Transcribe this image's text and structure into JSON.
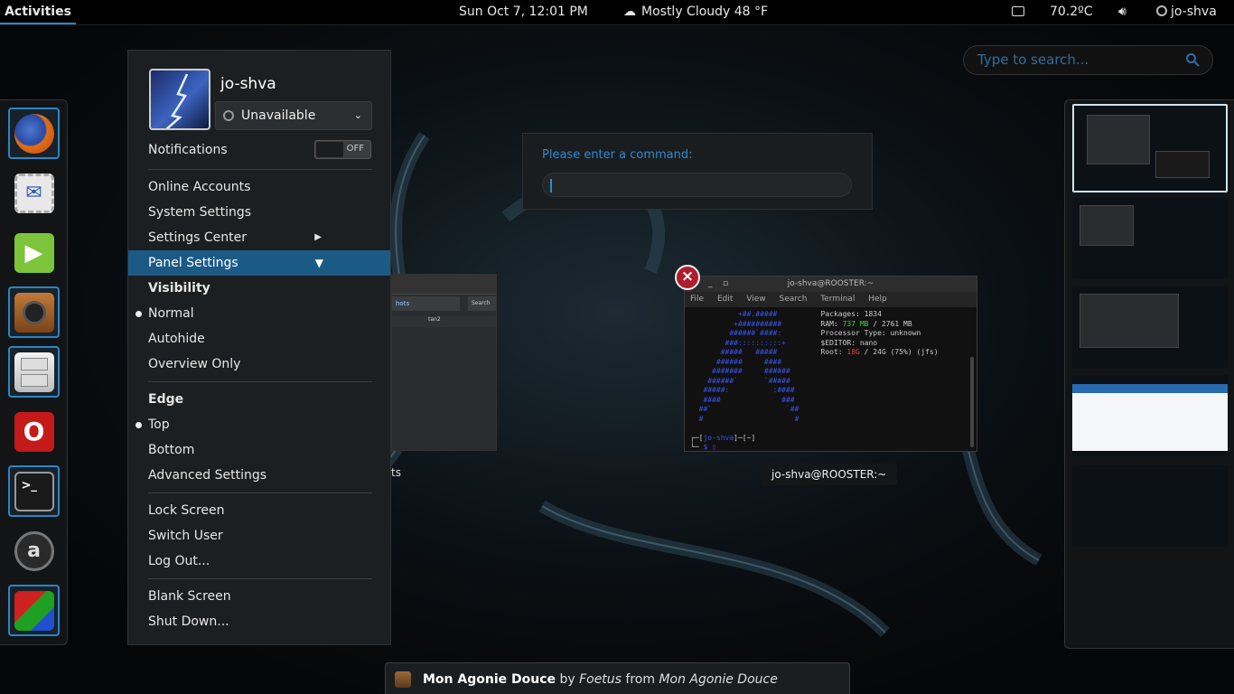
{
  "topbar": {
    "activities": "Activities",
    "clock": "Sun Oct  7, 12:01 PM",
    "weather": "Mostly Cloudy 48 °F",
    "temperature": "70.2ºC",
    "user": "jo-shva"
  },
  "search": {
    "placeholder": "Type to search..."
  },
  "dash": {
    "apps": [
      {
        "name": "Firefox",
        "running": true
      },
      {
        "name": "Thunderbird",
        "running": false
      },
      {
        "name": "Media Player",
        "running": false
      },
      {
        "name": "Rhythmbox",
        "running": true
      },
      {
        "name": "Files",
        "running": true
      },
      {
        "name": "Opera",
        "running": false
      },
      {
        "name": "Terminal",
        "running": true
      },
      {
        "name": "Amazon",
        "running": false
      },
      {
        "name": "Cube",
        "running": true
      }
    ]
  },
  "usermenu": {
    "name": "jo-shva",
    "status": "Unavailable",
    "notifications_label": "Notifications",
    "notifications_toggle": "OFF",
    "online_accounts": "Online Accounts",
    "system_settings": "System Settings",
    "settings_center": "Settings Center",
    "panel_settings": "Panel Settings",
    "visibility": "Visibility",
    "normal": "Normal",
    "autohide": "Autohide",
    "overview_only": "Overview Only",
    "edge": "Edge",
    "top": "Top",
    "bottom": "Bottom",
    "advanced_settings": "Advanced Settings",
    "lock_screen": "Lock Screen",
    "switch_user": "Switch User",
    "log_out": "Log Out...",
    "blank_screen": "Blank Screen",
    "shut_down": "Shut Down..."
  },
  "run_dialog": {
    "label": "Please enter a command:"
  },
  "windows": {
    "left_caption": "ts",
    "terminal_title": "jo-shva@ROOSTER:~",
    "terminal_caption": "jo-shva@ROOSTER:~",
    "terminal_menu": [
      "File",
      "Edit",
      "View",
      "Search",
      "Terminal",
      "Help"
    ],
    "terminal_info": {
      "packages": "Packages: 1834",
      "ram_label": "RAM: ",
      "ram_used": "737 MB",
      "ram_total": " / 2761 MB",
      "processor": "Processor Type: unknown",
      "editor": "$EDITOR: nano",
      "root_label": "Root: ",
      "root_used": "18G",
      "root_rest": " / 24G (75%) (jfs)",
      "prompt_user": "jo-shva",
      "prompt_path": "~"
    },
    "left_tabs": [
      "hots",
      "tan2"
    ],
    "left_search": "Search"
  },
  "notification": {
    "title": "Mon Agonie Douce",
    "by": "by",
    "artist": "Foetus",
    "from": "from",
    "album": "Mon Agonie Douce"
  },
  "colors": {
    "accent": "#2a86c4",
    "highlight": "#1c5a86",
    "close": "#b01d2a"
  }
}
